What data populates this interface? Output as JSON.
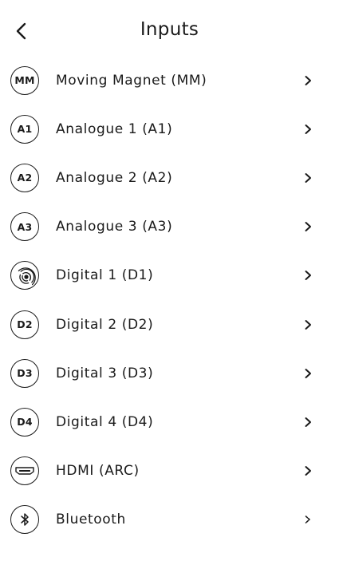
{
  "header": {
    "title": "Inputs",
    "back_icon": "chevron-left-icon"
  },
  "inputs": [
    {
      "badge": "MM",
      "label": "Moving Magnet (MM)",
      "icon": "text-badge"
    },
    {
      "badge": "A1",
      "label": "Analogue 1 (A1)",
      "icon": "text-badge"
    },
    {
      "badge": "A2",
      "label": "Analogue 2 (A2)",
      "icon": "text-badge"
    },
    {
      "badge": "A3",
      "label": "Analogue 3 (A3)",
      "icon": "text-badge"
    },
    {
      "badge": "",
      "label": "Digital 1 (D1)",
      "icon": "optical-disc-icon"
    },
    {
      "badge": "D2",
      "label": "Digital 2 (D2)",
      "icon": "text-badge"
    },
    {
      "badge": "D3",
      "label": "Digital 3 (D3)",
      "icon": "text-badge"
    },
    {
      "badge": "D4",
      "label": "Digital 4 (D4)",
      "icon": "text-badge"
    },
    {
      "badge": "",
      "label": "HDMI (ARC)",
      "icon": "hdmi-port-icon"
    },
    {
      "badge": "",
      "label": "Bluetooth",
      "icon": "bluetooth-icon"
    }
  ],
  "row_chevron_icon": "chevron-right-icon"
}
